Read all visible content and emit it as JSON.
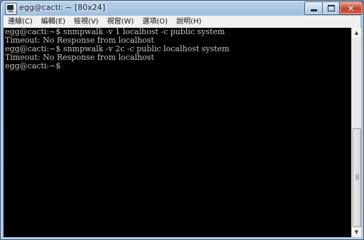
{
  "window": {
    "title": "egg@cacti: ~ [80x24]",
    "icon": "putty-terminal-icon",
    "controls": {
      "minimize": "minimize-icon",
      "maximize": "maximize-icon",
      "close": "close-icon"
    }
  },
  "menubar": {
    "items": [
      {
        "label": "連線(C)"
      },
      {
        "label": "編輯(E)"
      },
      {
        "label": "檢視(V)"
      },
      {
        "label": "視窗(W)"
      },
      {
        "label": "選項(O)"
      },
      {
        "label": "說明(H)"
      }
    ]
  },
  "terminal": {
    "background": "#000000",
    "foreground": "#c6c6c6",
    "lines": [
      "egg@cacti:~$ snmpwalk -v 1 localhost -c public system",
      "Timeout: No Response from localhost",
      "egg@cacti:~$ snmpwalk -v 2c -c public localhost system",
      "Timeout: No Response from localhost",
      "egg@cacti:~$"
    ]
  },
  "scrollbar": {
    "up": "arrow-up-icon",
    "down": "arrow-down-icon"
  }
}
